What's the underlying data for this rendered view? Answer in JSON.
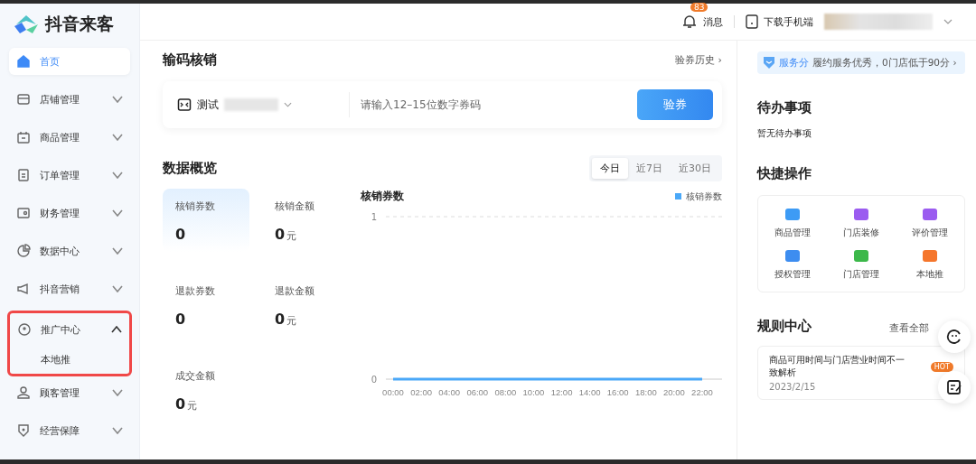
{
  "app": {
    "name": "抖音来客"
  },
  "sidebar": {
    "items": [
      {
        "label": "首页",
        "selected": true
      },
      {
        "label": "店铺管理",
        "selected": false,
        "expanded": false,
        "highlighted": false
      },
      {
        "label": "商品管理",
        "selected": false,
        "expanded": false,
        "highlighted": false
      },
      {
        "label": "订单管理",
        "selected": false,
        "expanded": false,
        "highlighted": false
      },
      {
        "label": "财务管理",
        "selected": false,
        "expanded": false,
        "highlighted": false
      },
      {
        "label": "数据中心",
        "selected": false,
        "expanded": false,
        "highlighted": false
      },
      {
        "label": "抖音营销",
        "selected": false,
        "expanded": false,
        "highlighted": false
      },
      {
        "label": "推广中心",
        "selected": false,
        "expanded": true,
        "highlighted": true,
        "children": [
          {
            "label": "本地推",
            "selected": false
          }
        ]
      },
      {
        "label": "顾客管理",
        "selected": false,
        "expanded": false,
        "highlighted": false
      },
      {
        "label": "经营保障",
        "selected": false,
        "expanded": false,
        "highlighted": false
      }
    ]
  },
  "header": {
    "notifications": {
      "label": "消息",
      "badge": "83"
    },
    "download": {
      "label": "下载手机端"
    }
  },
  "verify": {
    "title": "输码核销",
    "history_link": "验券历史 ›",
    "store": {
      "label": "测试"
    },
    "code_field": {
      "placeholder": "请输入12–15位数字券码"
    },
    "button": "验券"
  },
  "overview": {
    "title": "数据概览",
    "ranges": [
      {
        "label": "今日",
        "selected": true
      },
      {
        "label": "近7日",
        "selected": false
      },
      {
        "label": "近30日",
        "selected": false
      }
    ],
    "stats": [
      {
        "label": "核销券数",
        "value": "0",
        "selected": true
      },
      {
        "label": "核销金额",
        "value": "0",
        "unit": "元",
        "selected": false
      },
      {
        "label": "退款券数",
        "value": "0",
        "selected": false
      },
      {
        "label": "退款金额",
        "value": "0",
        "unit": "元",
        "selected": false
      },
      {
        "label": "成交金额",
        "value": "0",
        "unit": "元",
        "selected": false
      }
    ],
    "chart_data": {
      "type": "line",
      "title": "核销券数",
      "categories": [
        "00:00",
        "02:00",
        "04:00",
        "06:00",
        "08:00",
        "10:00",
        "12:00",
        "14:00",
        "16:00",
        "18:00",
        "20:00",
        "22:00"
      ],
      "series": [
        {
          "name": "核销券数",
          "color": "#4aa8f8",
          "values": [
            0,
            0,
            0,
            0,
            0,
            0,
            0,
            0,
            0,
            0,
            0,
            0
          ]
        }
      ],
      "ylim": [
        0,
        1
      ],
      "yticks": [
        0,
        1
      ]
    }
  },
  "right": {
    "service": {
      "label": "服务分",
      "text": "履约服务优秀，0门店低于90分 ›"
    },
    "todo": {
      "title": "待办事项",
      "empty": "暂无待办事项"
    },
    "shortcuts": {
      "title": "快捷操作",
      "items": [
        {
          "label": "商品管理",
          "color": "#3d9bf5"
        },
        {
          "label": "门店装修",
          "color": "#9b5cf0"
        },
        {
          "label": "评价管理",
          "color": "#9b5cf0"
        },
        {
          "label": "授权管理",
          "color": "#3d8df0"
        },
        {
          "label": "门店管理",
          "color": "#3cb84a"
        },
        {
          "label": "本地推",
          "color": "#f5762c"
        }
      ]
    },
    "rules": {
      "title": "规则中心",
      "link": "查看全部",
      "items": [
        {
          "title": "商品可用时间与门店营业时间不一致解析",
          "date": "2023/2/15",
          "badge": "HOT"
        }
      ]
    }
  }
}
